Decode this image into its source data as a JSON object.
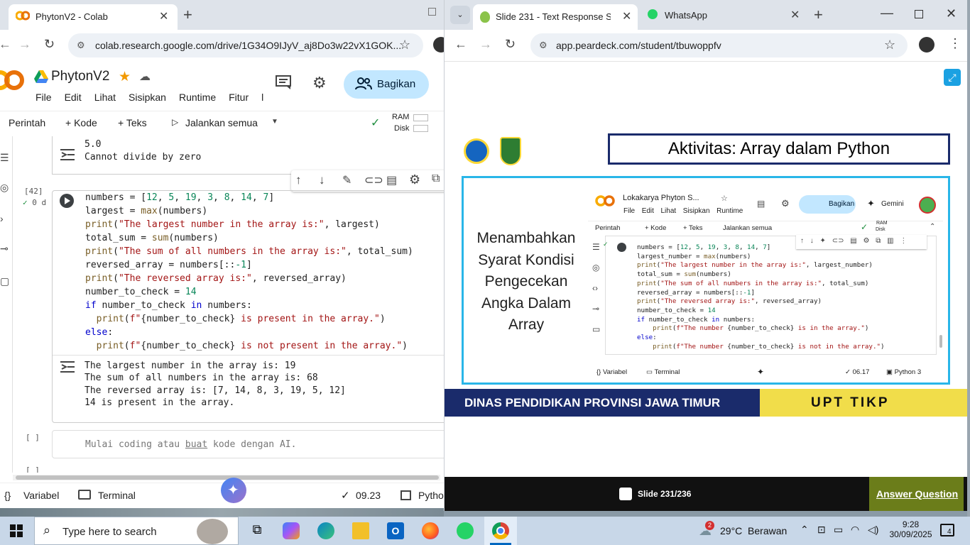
{
  "colab": {
    "tab_title": "PhytonV2 - Colab",
    "url": "colab.research.google.com/drive/1G34O9IJyV_aj8Do3w22vX1GOK...",
    "notebook_title": "PhytonV2",
    "menu": [
      "File",
      "Edit",
      "Lihat",
      "Sisipkan",
      "Runtime",
      "Fitur",
      "l"
    ],
    "share_label": "Bagikan",
    "toolbar": {
      "commands": "Perintah",
      "add_code": "+ Kode",
      "add_text": "+ Teks",
      "run_all": "Jalankan semua",
      "ram": "RAM",
      "disk": "Disk"
    },
    "prev_output": [
      "42",
      "5.0",
      "Cannot divide by zero"
    ],
    "cell_exec": "[42]",
    "cell_time": "0 d",
    "output": [
      "The largest number in the array is: 19",
      "The sum of all numbers in the array is: 68",
      "The reversed array is: [7, 14, 8, 3, 19, 5, 12]",
      "14 is present in the array."
    ],
    "empty_cell_exec": "[ ]",
    "empty_cell_exec2": "[ ]",
    "empty_placeholder_pre": "Mulai coding atau ",
    "empty_placeholder_link": "buat",
    "empty_placeholder_post": " kode dengan AI.",
    "status": {
      "variables": "Variabel",
      "terminal": "Terminal",
      "time": "09.23",
      "python": "Pytho"
    }
  },
  "peardeck": {
    "tabs": [
      {
        "title": "Slide 231 - Text Response Slide"
      },
      {
        "title": "WhatsApp"
      }
    ],
    "url": "app.peardeck.com/student/tbuwoppfv",
    "slide": {
      "title": "Aktivitas: Array dalam Python",
      "left_text": [
        "Menambahkan",
        "Syarat Kondisi",
        "Pengecekan",
        "Angka Dalam",
        "Array"
      ],
      "footer_left": "DINAS PENDIDIKAN PROVINSI JAWA TIMUR",
      "footer_right": "UPT TIKP",
      "screenshot": {
        "title": "Lokakarya Phyton S...",
        "menu": [
          "File",
          "Edit",
          "Lihat",
          "Sisipkan",
          "Runtime"
        ],
        "share": "Bagikan",
        "gemini": "Gemini",
        "toolbar": {
          "commands": "Perintah",
          "add_code": "+ Kode",
          "add_text": "+ Teks",
          "run_all": "Jalankan semua",
          "ram": "RAM",
          "disk": "Disk"
        },
        "status": {
          "variables": "Variabel",
          "terminal": "Terminal",
          "time": "06.17",
          "python": "Python 3"
        }
      }
    },
    "slide_counter": "Slide 231/236",
    "answer_button": "Answer Question"
  },
  "taskbar": {
    "search_placeholder": "Type here to search",
    "weather": "29°C  Berawan",
    "weather_badge": "2",
    "time": "9:28",
    "date": "30/09/2025",
    "notifications": "4"
  }
}
